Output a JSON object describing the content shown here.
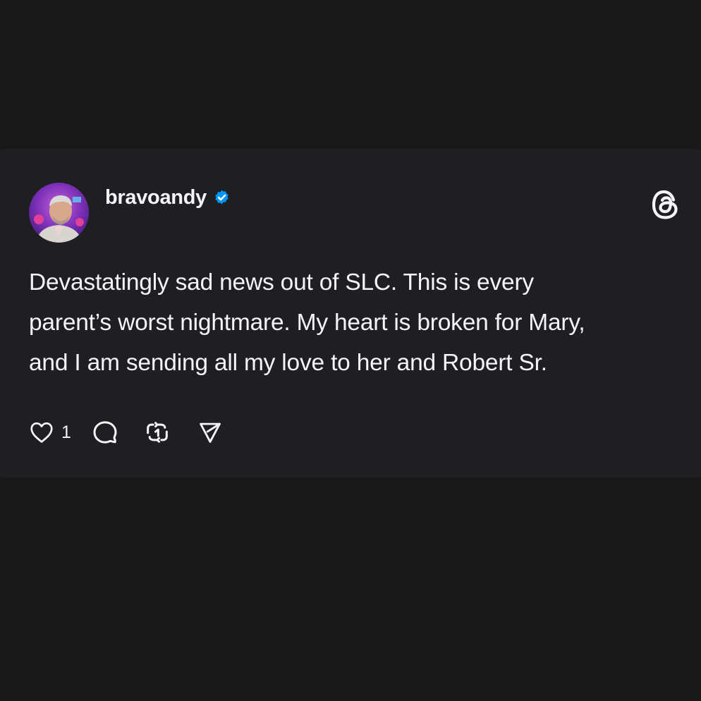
{
  "post": {
    "username": "bravoandy",
    "verified_icon": "verified-badge-icon",
    "text": "Devastatingly sad news out of SLC. This is every\nparent’s worst nightmare. My heart is broken for Mary,\nand I am sending all my love to her and Robert Sr.",
    "like_count": "1"
  },
  "icons": {
    "app": "threads-logo-icon",
    "like": "heart-icon",
    "reply": "comment-icon",
    "repost": "repost-icon",
    "share": "send-icon"
  },
  "colors": {
    "background": "#181818",
    "card": "#1f1f21",
    "text": "#f3f5f7",
    "verified": "#0095f6"
  }
}
